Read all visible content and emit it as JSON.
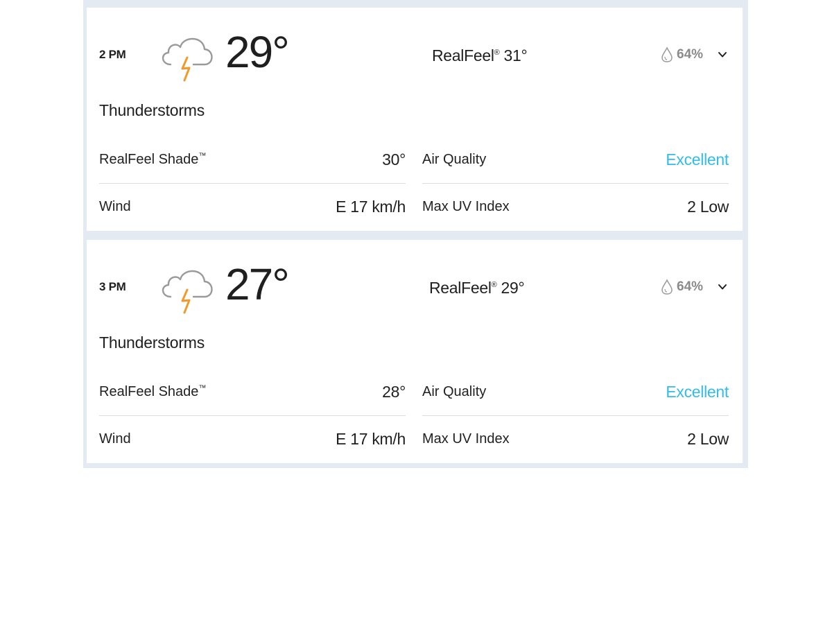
{
  "colors": {
    "accent_good": "#33bce9",
    "bolt": "#f19a2b",
    "cloud_outline": "#9a9a9a",
    "background": "#e4eaf2"
  },
  "icons": {
    "weather": "thunderstorm-icon",
    "precipitation": "raindrop-icon",
    "expand": "chevron-down-icon"
  },
  "hours": [
    {
      "time": "2 PM",
      "temp": "29°",
      "realfeel_label": "RealFeel",
      "realfeel_mark": "®",
      "realfeel_value": " 31°",
      "precip": "64%",
      "phrase": "Thunderstorms",
      "shade_label": "RealFeel Shade",
      "shade_mark": "™",
      "shade_value": "30°",
      "wind_label": "Wind",
      "wind_value": "E 17 km/h",
      "aq_label": "Air Quality",
      "aq_value": "Excellent",
      "uv_label": "Max UV Index",
      "uv_value": "2 Low"
    },
    {
      "time": "3 PM",
      "temp": "27°",
      "realfeel_label": "RealFeel",
      "realfeel_mark": "®",
      "realfeel_value": " 29°",
      "precip": "64%",
      "phrase": "Thunderstorms",
      "shade_label": "RealFeel Shade",
      "shade_mark": "™",
      "shade_value": "28°",
      "wind_label": "Wind",
      "wind_value": "E 17 km/h",
      "aq_label": "Air Quality",
      "aq_value": "Excellent",
      "uv_label": "Max UV Index",
      "uv_value": "2 Low"
    }
  ]
}
